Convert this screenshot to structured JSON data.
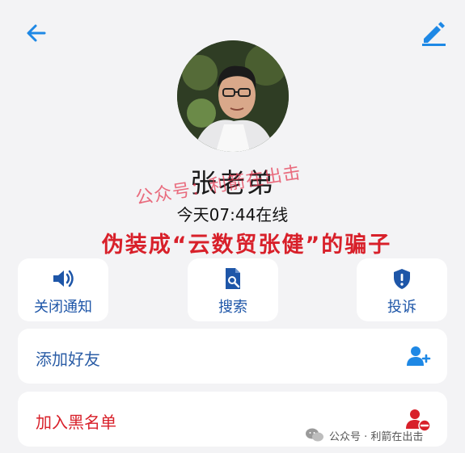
{
  "header": {
    "back_icon": "arrow-left-icon",
    "edit_icon": "edit-pencil-icon",
    "accent_color": "#1e88e5"
  },
  "profile": {
    "name": "张老弟",
    "status": "今天07:44在线"
  },
  "watermark": "公众号：利箭在出击",
  "caption": "伪装成“云数贸张健”的骗子",
  "actions": [
    {
      "label": "关闭通知",
      "icon": "speaker-icon"
    },
    {
      "label": "搜索",
      "icon": "search-document-icon"
    },
    {
      "label": "投诉",
      "icon": "shield-alert-icon"
    }
  ],
  "rows": [
    {
      "label": "添加好友",
      "icon": "add-user-icon",
      "color": "#2b5da6"
    },
    {
      "label": "加入黑名单",
      "icon": "block-user-icon",
      "color": "#d8202a"
    }
  ],
  "footer": {
    "text": "公众号 · 利箭在出击",
    "icon": "wechat-icon"
  }
}
